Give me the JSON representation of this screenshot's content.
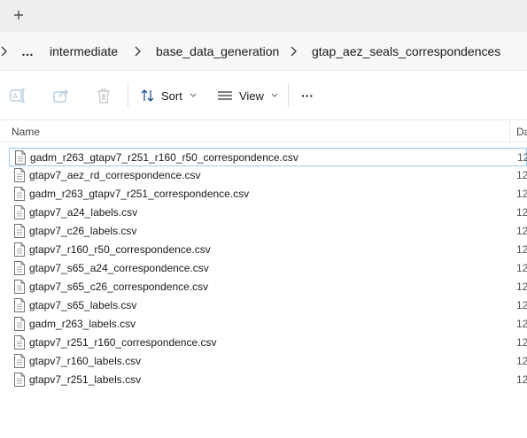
{
  "tabstrip": {
    "new_tab_icon": "plus-icon"
  },
  "address": {
    "breadcrumbs": [
      "…",
      "intermediate",
      "base_data_generation",
      "gtap_aez_seals_correspondences"
    ]
  },
  "toolbar": {
    "sort_label": "Sort",
    "view_label": "View",
    "more_label": "···"
  },
  "columns": {
    "name": "Name",
    "date": "Da"
  },
  "files": [
    {
      "name": "gadm_r263_gtapv7_r251_r160_r50_correspondence.csv",
      "date": "12"
    },
    {
      "name": "gtapv7_aez_rd_correspondence.csv",
      "date": "12"
    },
    {
      "name": "gadm_r263_gtapv7_r251_correspondence.csv",
      "date": "12"
    },
    {
      "name": "gtapv7_a24_labels.csv",
      "date": "12"
    },
    {
      "name": "gtapv7_c26_labels.csv",
      "date": "12"
    },
    {
      "name": "gtapv7_r160_r50_correspondence.csv",
      "date": "12"
    },
    {
      "name": "gtapv7_s65_a24_correspondence.csv",
      "date": "12"
    },
    {
      "name": "gtapv7_s65_c26_correspondence.csv",
      "date": "12"
    },
    {
      "name": "gtapv7_s65_labels.csv",
      "date": "12"
    },
    {
      "name": "gadm_r263_labels.csv",
      "date": "12"
    },
    {
      "name": "gtapv7_r251_r160_correspondence.csv",
      "date": "12"
    },
    {
      "name": "gtapv7_r160_labels.csv",
      "date": "12"
    },
    {
      "name": "gtapv7_r251_labels.csv",
      "date": "12"
    }
  ],
  "selected_index": 0
}
